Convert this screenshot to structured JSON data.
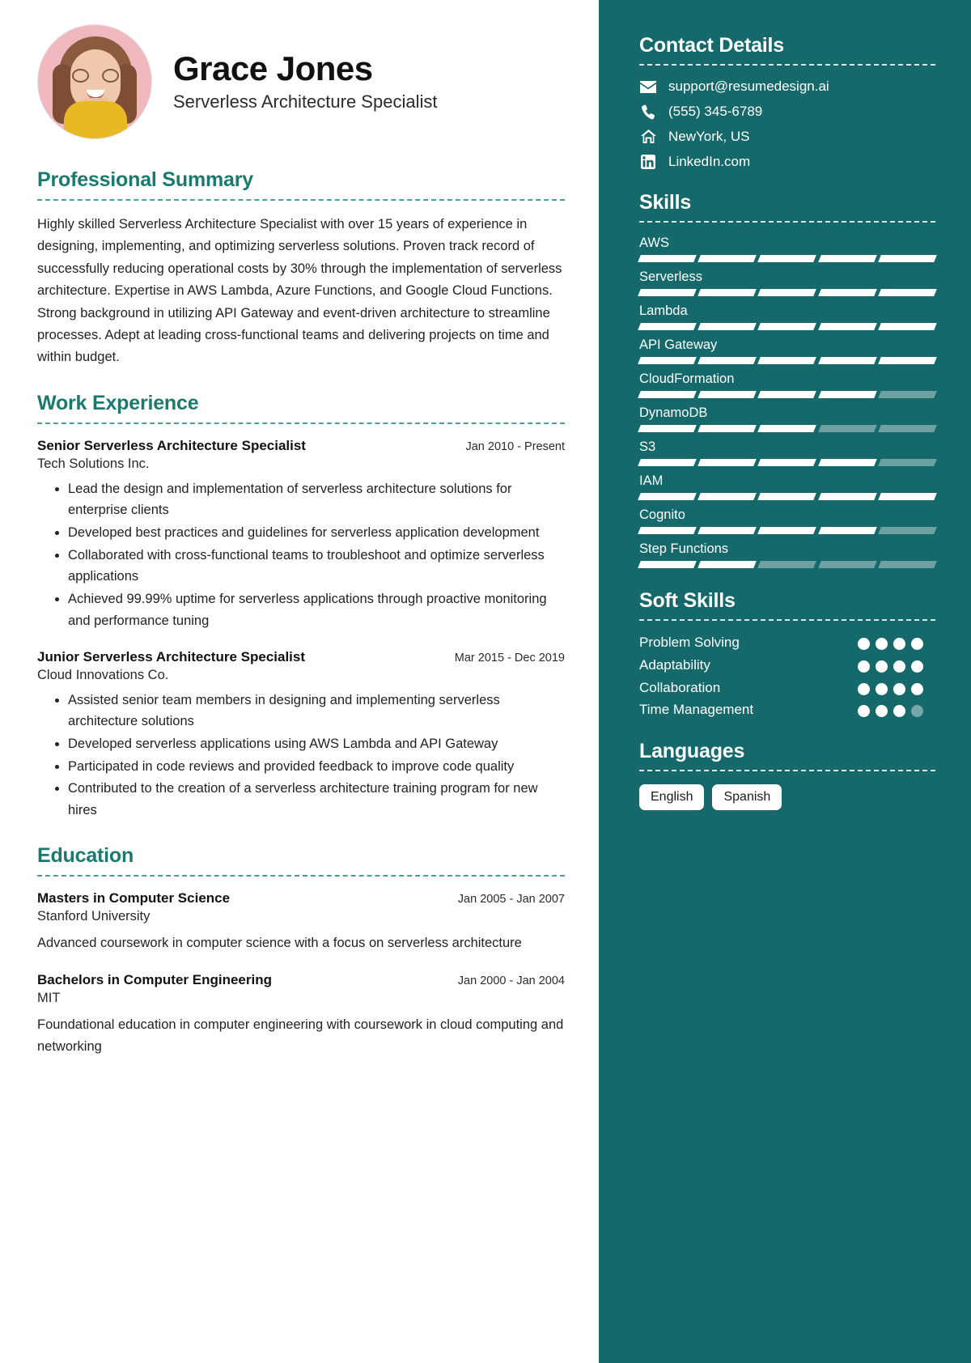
{
  "theme": {
    "sidebar_bg": "#15696a",
    "heading_color": "#1b7a6d",
    "accent_white": "#ffffff",
    "avatar_bg": "#f2b8c0"
  },
  "header": {
    "name": "Grace Jones",
    "job_title": "Serverless Architecture Specialist"
  },
  "summary": {
    "title": "Professional Summary",
    "text": "Highly skilled Serverless Architecture Specialist with over 15 years of experience in designing, implementing, and optimizing serverless solutions. Proven track record of successfully reducing operational costs by 30% through the implementation of serverless architecture. Expertise in AWS Lambda, Azure Functions, and Google Cloud Functions. Strong background in utilizing API Gateway and event-driven architecture to streamline processes. Adept at leading cross-functional teams and delivering projects on time and within budget."
  },
  "work": {
    "title": "Work Experience",
    "entries": [
      {
        "role": "Senior Serverless Architecture Specialist",
        "date": "Jan 2010 - Present",
        "org": "Tech Solutions Inc.",
        "bullets": [
          "Lead the design and implementation of serverless architecture solutions for enterprise clients",
          "Developed best practices and guidelines for serverless application development",
          "Collaborated with cross-functional teams to troubleshoot and optimize serverless applications",
          "Achieved 99.99% uptime for serverless applications through proactive monitoring and performance tuning"
        ]
      },
      {
        "role": "Junior Serverless Architecture Specialist",
        "date": "Mar 2015 - Dec 2019",
        "org": "Cloud Innovations Co.",
        "bullets": [
          "Assisted senior team members in designing and implementing serverless architecture solutions",
          "Developed serverless applications using AWS Lambda and API Gateway",
          "Participated in code reviews and provided feedback to improve code quality",
          "Contributed to the creation of a serverless architecture training program for new hires"
        ]
      }
    ]
  },
  "education": {
    "title": "Education",
    "entries": [
      {
        "degree": "Masters in Computer Science",
        "date": "Jan 2005 - Jan 2007",
        "school": "Stanford University",
        "description": "Advanced coursework in computer science with a focus on serverless architecture"
      },
      {
        "degree": "Bachelors in Computer Engineering",
        "date": "Jan 2000 - Jan 2004",
        "school": "MIT",
        "description": "Foundational education in computer engineering with coursework in cloud computing and networking"
      }
    ]
  },
  "contact": {
    "title": "Contact Details",
    "items": [
      {
        "icon": "envelope-icon",
        "value": "support@resumedesign.ai"
      },
      {
        "icon": "phone-icon",
        "value": "(555) 345-6789"
      },
      {
        "icon": "home-icon",
        "value": "NewYork, US"
      },
      {
        "icon": "linkedin-icon",
        "value": "LinkedIn.com"
      }
    ]
  },
  "skills": {
    "title": "Skills",
    "segments_total": 5,
    "items": [
      {
        "name": "AWS",
        "filled": 5
      },
      {
        "name": "Serverless",
        "filled": 5
      },
      {
        "name": "Lambda",
        "filled": 5
      },
      {
        "name": "API Gateway",
        "filled": 5
      },
      {
        "name": "CloudFormation",
        "filled": 4
      },
      {
        "name": "DynamoDB",
        "filled": 3
      },
      {
        "name": "S3",
        "filled": 4
      },
      {
        "name": "IAM",
        "filled": 5
      },
      {
        "name": "Cognito",
        "filled": 4
      },
      {
        "name": "Step Functions",
        "filled": 2
      }
    ]
  },
  "soft_skills": {
    "title": "Soft Skills",
    "dots_total": 4,
    "items": [
      {
        "name": "Problem Solving",
        "filled": 4
      },
      {
        "name": "Adaptability",
        "filled": 4
      },
      {
        "name": "Collaboration",
        "filled": 4
      },
      {
        "name": "Time Management",
        "filled": 3
      }
    ]
  },
  "languages": {
    "title": "Languages",
    "items": [
      "English",
      "Spanish"
    ]
  }
}
